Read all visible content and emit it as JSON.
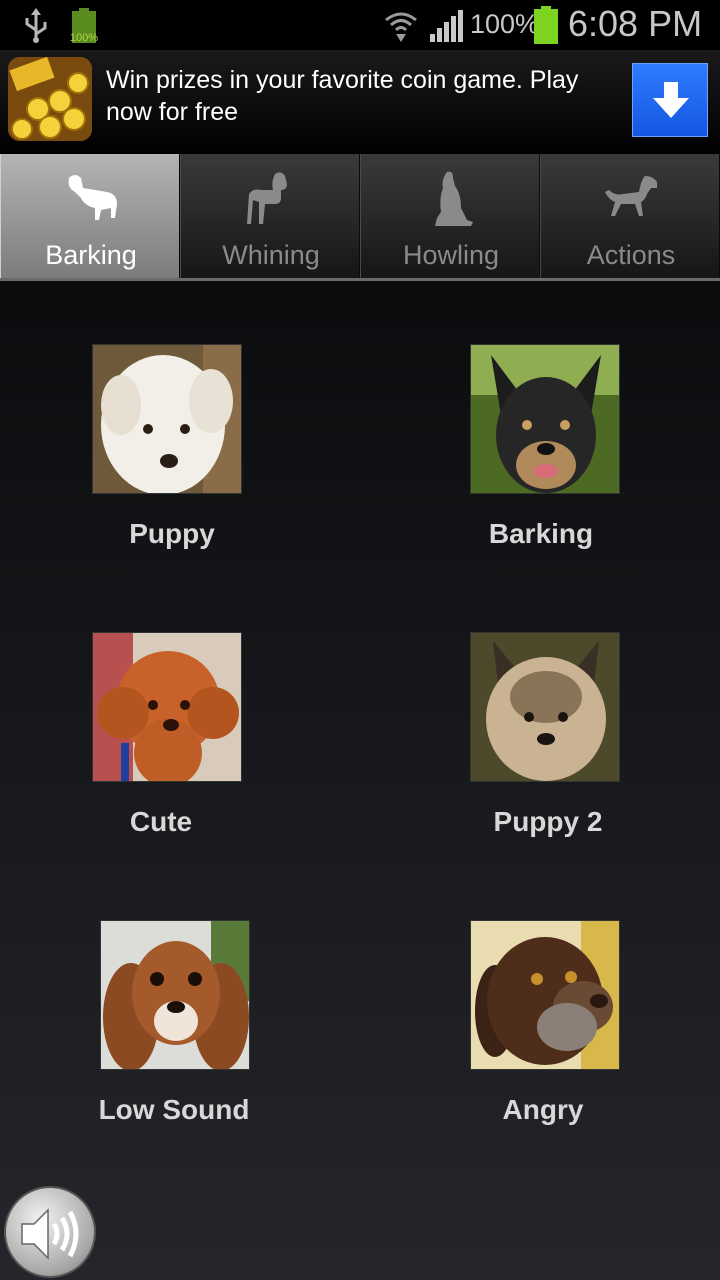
{
  "status_bar": {
    "small_battery_pct": "100%",
    "battery_pct": "100%",
    "time": "6:08 PM",
    "battery_color": "#7ed321",
    "icons": [
      "usb-icon",
      "battery-icon",
      "wifi-icon",
      "signal-icon",
      "battery-icon"
    ]
  },
  "ad": {
    "text": "Win prizes in your favorite coin game. Play now for free",
    "icon": "coin-game-app-icon",
    "download_icon": "download-arrow-icon",
    "accent_color": "#1f66f0"
  },
  "tabs": [
    {
      "label": "Barking",
      "icon": "dog-silhouette-icon",
      "active": true
    },
    {
      "label": "Whining",
      "icon": "dog-standing-icon",
      "active": false
    },
    {
      "label": "Howling",
      "icon": "dog-sitting-icon",
      "active": false
    },
    {
      "label": "Actions",
      "icon": "dog-walking-icon",
      "active": false
    }
  ],
  "sounds": [
    {
      "label": "Puppy",
      "image": "white-puppy-photo"
    },
    {
      "label": "Barking",
      "image": "black-terrier-photo"
    },
    {
      "label": "Cute",
      "image": "red-poodle-photo"
    },
    {
      "label": "Puppy 2",
      "image": "yorkshire-terrier-photo"
    },
    {
      "label": "Low Sound",
      "image": "cavalier-spaniel-photo"
    },
    {
      "label": "Angry",
      "image": "chocolate-labrador-photo"
    }
  ],
  "speaker_button": {
    "icon": "speaker-volume-icon"
  }
}
